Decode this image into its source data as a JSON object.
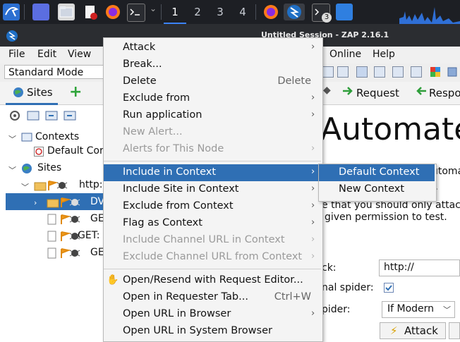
{
  "taskbar": {
    "workspaces": [
      "1",
      "2",
      "3",
      "4"
    ],
    "active_workspace": "1",
    "terminal_badge": "3",
    "accent": "#3b82f6"
  },
  "window": {
    "title": "Untitled Session - ZAP 2.16.1"
  },
  "menubar": {
    "items": [
      "File",
      "Edit",
      "View",
      "Online",
      "Help"
    ]
  },
  "toolbar": {
    "mode": "Standard Mode"
  },
  "sites_panel": {
    "tab_label": "Sites",
    "tree": {
      "contexts_label": "Contexts",
      "default_context_label": "Default Cor",
      "sites_label": "Sites",
      "host_label": "http:",
      "selected_label": "DV",
      "children": [
        "GE",
        "GET:",
        "GE"
      ]
    }
  },
  "right_panel": {
    "request_tab": "Request",
    "response_tab": "Respo",
    "heading": "Automate",
    "para_1": "utoma",
    "para_2": "r.",
    "para_3": "e that you should only attac",
    "para_4": "given permission to test.",
    "url_label": "ck:",
    "url_value": "http://",
    "spider_label": "nal spider:",
    "ajax_label": "pider:",
    "ajax_value": "If Modern",
    "attack_button": "Attack"
  },
  "context_menu": {
    "items": [
      {
        "label": "Attack",
        "submenu": true,
        "disabled": false,
        "shortcut": ""
      },
      {
        "label": "Break...",
        "submenu": false,
        "disabled": false,
        "shortcut": ""
      },
      {
        "label": "Delete",
        "submenu": false,
        "disabled": false,
        "shortcut": "Delete"
      },
      {
        "label": "Exclude from",
        "submenu": true,
        "disabled": false,
        "shortcut": ""
      },
      {
        "label": "Run application",
        "submenu": true,
        "disabled": false,
        "shortcut": ""
      },
      {
        "label": "New Alert...",
        "submenu": false,
        "disabled": true,
        "shortcut": ""
      },
      {
        "label": "Alerts for This Node",
        "submenu": true,
        "disabled": true,
        "shortcut": ""
      },
      {
        "label": "Include in Context",
        "submenu": true,
        "disabled": false,
        "shortcut": "",
        "highlighted": true
      },
      {
        "label": "Include Site in Context",
        "submenu": true,
        "disabled": false,
        "shortcut": ""
      },
      {
        "label": "Exclude from Context",
        "submenu": true,
        "disabled": false,
        "shortcut": ""
      },
      {
        "label": "Flag as Context",
        "submenu": true,
        "disabled": false,
        "shortcut": ""
      },
      {
        "label": "Include Channel URL in Context",
        "submenu": true,
        "disabled": true,
        "shortcut": ""
      },
      {
        "label": "Exclude Channel URL from Context",
        "submenu": true,
        "disabled": true,
        "shortcut": ""
      },
      {
        "label": "Open/Resend with Request Editor...",
        "submenu": false,
        "disabled": false,
        "shortcut": ""
      },
      {
        "label": "Open in Requester Tab...",
        "submenu": false,
        "disabled": false,
        "shortcut": "Ctrl+W"
      },
      {
        "label": "Open URL in Browser",
        "submenu": true,
        "disabled": false,
        "shortcut": ""
      },
      {
        "label": "Open URL in System Browser",
        "submenu": false,
        "disabled": false,
        "shortcut": ""
      }
    ]
  },
  "submenu": {
    "items": [
      {
        "label": "Default Context",
        "highlighted": true
      },
      {
        "label": "New Context",
        "highlighted": false
      }
    ]
  }
}
